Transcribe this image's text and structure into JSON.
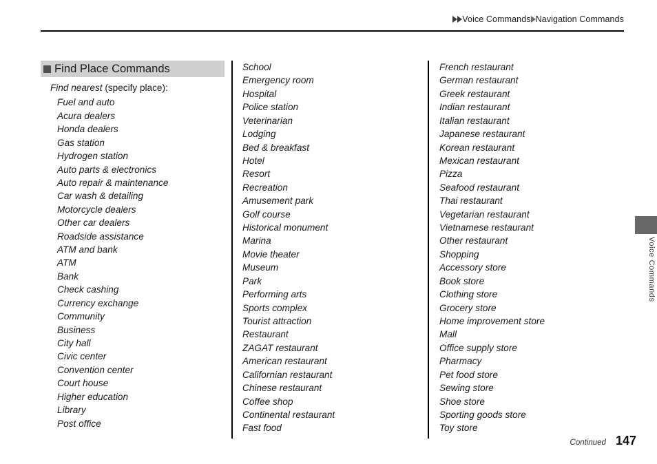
{
  "header": {
    "breadcrumb": {
      "icon_1": "triangle-right-icon",
      "icon_2": "triangle-right-icon",
      "crumb_1": "Voice Commands",
      "icon_3": "triangle-right-icon",
      "crumb_2": "Navigation Commands"
    }
  },
  "section": {
    "bullet_icon": "square-bullet-icon",
    "title": "Find Place Commands",
    "intro_italic": "Find nearest",
    "intro_plain": " (specify place):"
  },
  "columns": [
    {
      "name": "column-1",
      "items": [
        "Fuel and auto",
        "Acura dealers",
        "Honda dealers",
        "Gas station",
        "Hydrogen station",
        "Auto parts & electronics",
        "Auto repair & maintenance",
        "Car wash & detailing",
        "Motorcycle dealers",
        "Other car dealers",
        "Roadside assistance",
        "ATM and bank",
        "ATM",
        "Bank",
        "Check cashing",
        "Currency exchange",
        "Community",
        "Business",
        "City hall",
        "Civic center",
        "Convention center",
        "Court house",
        "Higher education",
        "Library",
        "Post office"
      ]
    },
    {
      "name": "column-2",
      "items": [
        "School",
        "Emergency room",
        "Hospital",
        "Police station",
        "Veterinarian",
        "Lodging",
        "Bed & breakfast",
        "Hotel",
        "Resort",
        "Recreation",
        "Amusement park",
        "Golf course",
        "Historical monument",
        "Marina",
        "Movie theater",
        "Museum",
        "Park",
        "Performing arts",
        "Sports complex",
        "Tourist attraction",
        "Restaurant",
        "ZAGAT restaurant",
        "American restaurant",
        "Californian restaurant",
        "Chinese restaurant",
        "Coffee shop",
        "Continental restaurant",
        "Fast food"
      ]
    },
    {
      "name": "column-3",
      "items": [
        "French restaurant",
        "German restaurant",
        "Greek restaurant",
        "Indian restaurant",
        "Italian restaurant",
        "Japanese restaurant",
        "Korean restaurant",
        "Mexican restaurant",
        "Pizza",
        "Seafood restaurant",
        "Thai restaurant",
        "Vegetarian restaurant",
        "Vietnamese restaurant",
        "Other restaurant",
        "Shopping",
        "Accessory store",
        "Book store",
        "Clothing store",
        "Grocery store",
        "Home improvement store",
        "Mall",
        "Office supply store",
        "Pharmacy",
        "Pet food store",
        "Sewing store",
        "Shoe store",
        "Sporting goods store",
        "Toy store"
      ]
    }
  ],
  "side_tab": {
    "label": "Voice Commands"
  },
  "footer": {
    "continued": "Continued",
    "page_number": "147"
  },
  "colors": {
    "heading_bar": "#cfcfcf",
    "heading_bullet": "#4f4f4f",
    "side_tab_block": "#686868",
    "rule": "#000000",
    "text": "#1a1a1a"
  }
}
